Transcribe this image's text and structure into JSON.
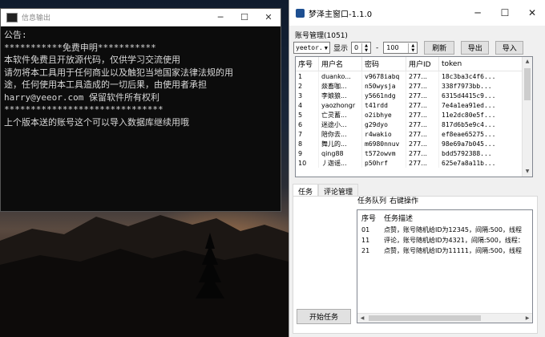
{
  "console": {
    "title": "信息输出",
    "lines": [
      "公告:",
      "***********免费申明***********",
      "本软件免费且开放源代码，仅供学习交流使用",
      "请勿将本工具用于任何商业以及触犯当地国家法律法规的用",
      "途，任何使用本工具造成的一切后果，由使用者承担",
      "harry@yeeor.com 保留软件所有权利",
      "******************************",
      "上个版本送的账号这个可以导入数据库继续用哦"
    ]
  },
  "app": {
    "title": "梦泽主窗口-1.1.0",
    "account_group": "账号管理(1051)",
    "select_value": "yeetor.",
    "display_label": "显示",
    "range_from": "0",
    "range_dash": "-",
    "range_to": "100",
    "refresh": "刷新",
    "export": "导出",
    "import": "导入",
    "columns": [
      "序号",
      "用户名",
      "密码",
      "用户ID",
      "token"
    ],
    "rows": [
      [
        "1",
        "duanko...",
        "v9678iabq",
        "277...",
        "18c3ba3c4f6..."
      ],
      [
        "2",
        "燚畜咖...",
        "n50wysja",
        "277...",
        "338f7973bb..."
      ],
      [
        "3",
        "李娘狼...",
        "y5661ndg",
        "277...",
        "6315d4415c9..."
      ],
      [
        "4",
        "yaozhongr",
        "t41rdd",
        "277...",
        "7e4a1ea91ed..."
      ],
      [
        "5",
        "亡灵蓄...",
        "o2ibhye",
        "277...",
        "11e2dc80e5f..."
      ],
      [
        "6",
        "迷途小...",
        "g29dyo",
        "277...",
        "817d6b5e9c4..."
      ],
      [
        "7",
        "陪你去...",
        "r4wakio",
        "277...",
        "ef8eae65275..."
      ],
      [
        "8",
        "舞儿的...",
        "m6980nnuv",
        "277...",
        "98e69a7b045..."
      ],
      [
        "9",
        "qing88",
        "t572owvm",
        "277...",
        "bdd5792388..."
      ],
      [
        "10",
        "丿迦谣...",
        "p50hrf",
        "277...",
        "625e7a8a11b..."
      ]
    ],
    "tabs": [
      "任务",
      "评论管理"
    ],
    "inner_tabs": [
      "任务队列",
      "右键操作"
    ],
    "task_columns": [
      "序号",
      "任务描述"
    ],
    "tasks": [
      [
        "01",
        "点赞，账号随机给ID为12345，间隔:500，线程"
      ],
      [
        "11",
        "评论，账号随机给ID为4321，间隔:500，线程："
      ],
      [
        "21",
        "点赞，账号随机给ID为11111，间隔:500，线程"
      ]
    ],
    "start_task": "开始任务"
  }
}
